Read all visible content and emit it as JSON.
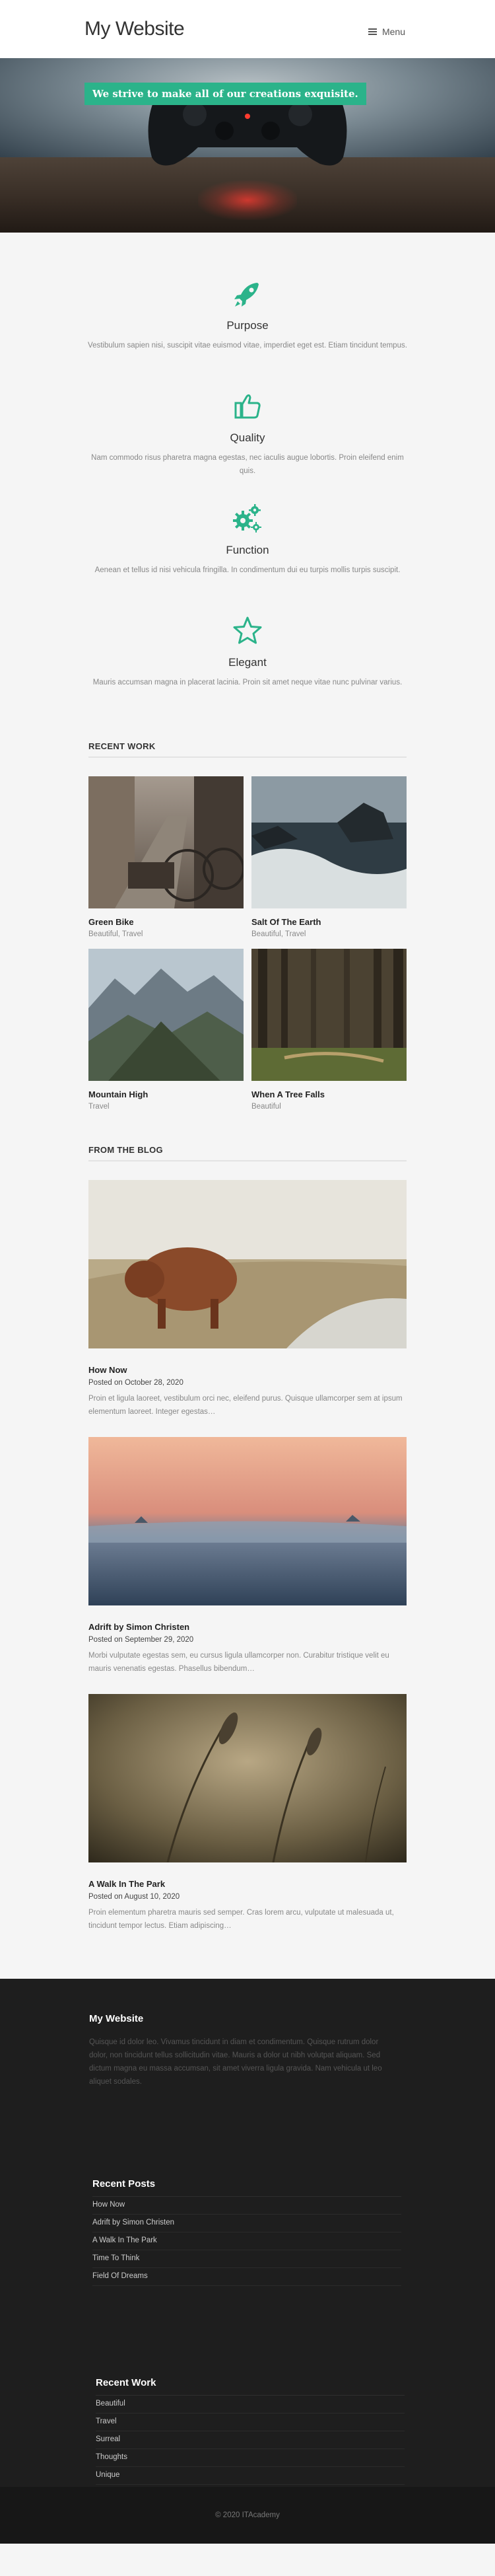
{
  "header": {
    "logo": "My Website",
    "menu_label": "Menu"
  },
  "hero": {
    "tagline": "We strive to make all of our creations exquisite."
  },
  "features": [
    {
      "icon": "rocket-icon",
      "title": "Purpose",
      "text": "Vestibulum sapien nisi, suscipit vitae euismod vitae, imperdiet eget est. Etiam tincidunt tempus."
    },
    {
      "icon": "thumbs-up-icon",
      "title": "Quality",
      "text": "Nam commodo risus pharetra magna egestas, nec iaculis augue lobortis. Proin eleifend enim quis."
    },
    {
      "icon": "gears-icon",
      "title": "Function",
      "text": "Aenean et tellus id nisi vehicula fringilla. In condimentum dui eu turpis mollis turpis suscipit."
    },
    {
      "icon": "star-icon",
      "title": "Elegant",
      "text": "Mauris accumsan magna in placerat lacinia. Proin sit amet neque vitae nunc pulvinar varius."
    }
  ],
  "recent_work": {
    "title": "RECENT WORK",
    "items": [
      {
        "title": "Green Bike",
        "category": "Beautiful, Travel"
      },
      {
        "title": "Salt Of The Earth",
        "category": "Beautiful, Travel"
      },
      {
        "title": "Mountain High",
        "category": "Travel"
      },
      {
        "title": "When A Tree Falls",
        "category": "Beautiful"
      }
    ]
  },
  "blog": {
    "title": "FROM THE BLOG",
    "posts": [
      {
        "title": "How Now",
        "date": "Posted on October 28, 2020",
        "excerpt": "Proin et ligula laoreet, vestibulum orci nec, eleifend purus. Quisque ullamcorper sem at ipsum elementum laoreet. Integer egestas…"
      },
      {
        "title": "Adrift by Simon Christen",
        "date": "Posted on September 29, 2020",
        "excerpt": "Morbi vulputate egestas sem, eu cursus ligula ullamcorper non. Curabitur tristique velit eu mauris venenatis egestas. Phasellus bibendum…"
      },
      {
        "title": "A Walk In The Park",
        "date": "Posted on August 10, 2020",
        "excerpt": "Proin elementum pharetra mauris sed semper. Cras lorem arcu, vulputate ut malesuada ut, tincidunt tempor lectus. Etiam adipiscing…"
      }
    ]
  },
  "footer": {
    "about_title": "My Website",
    "about_text": "Quisque id dolor leo. Vivamus tincidunt in diam et condimentum. Quisque rutrum dolor dolor, non tincidunt tellus sollicitudin vitae. Mauris a dolor ut nibh volutpat aliquam. Sed dictum magna eu massa accumsan, sit amet viverra ligula gravida. Nam vehicula ut leo aliquet sodales.",
    "recent_posts_title": "Recent Posts",
    "recent_posts": [
      "How Now",
      "Adrift by Simon Christen",
      "A Walk In The Park",
      "Time To Think",
      "Field Of Dreams"
    ],
    "recent_work_title": "Recent Work",
    "recent_work": [
      "Beautiful",
      "Travel",
      "Surreal",
      "Thoughts",
      "Unique"
    ],
    "copyright": "© 2020 ITAcademy"
  },
  "colors": {
    "accent": "#2bb38a",
    "footer_bg": "#1e1e1e"
  }
}
